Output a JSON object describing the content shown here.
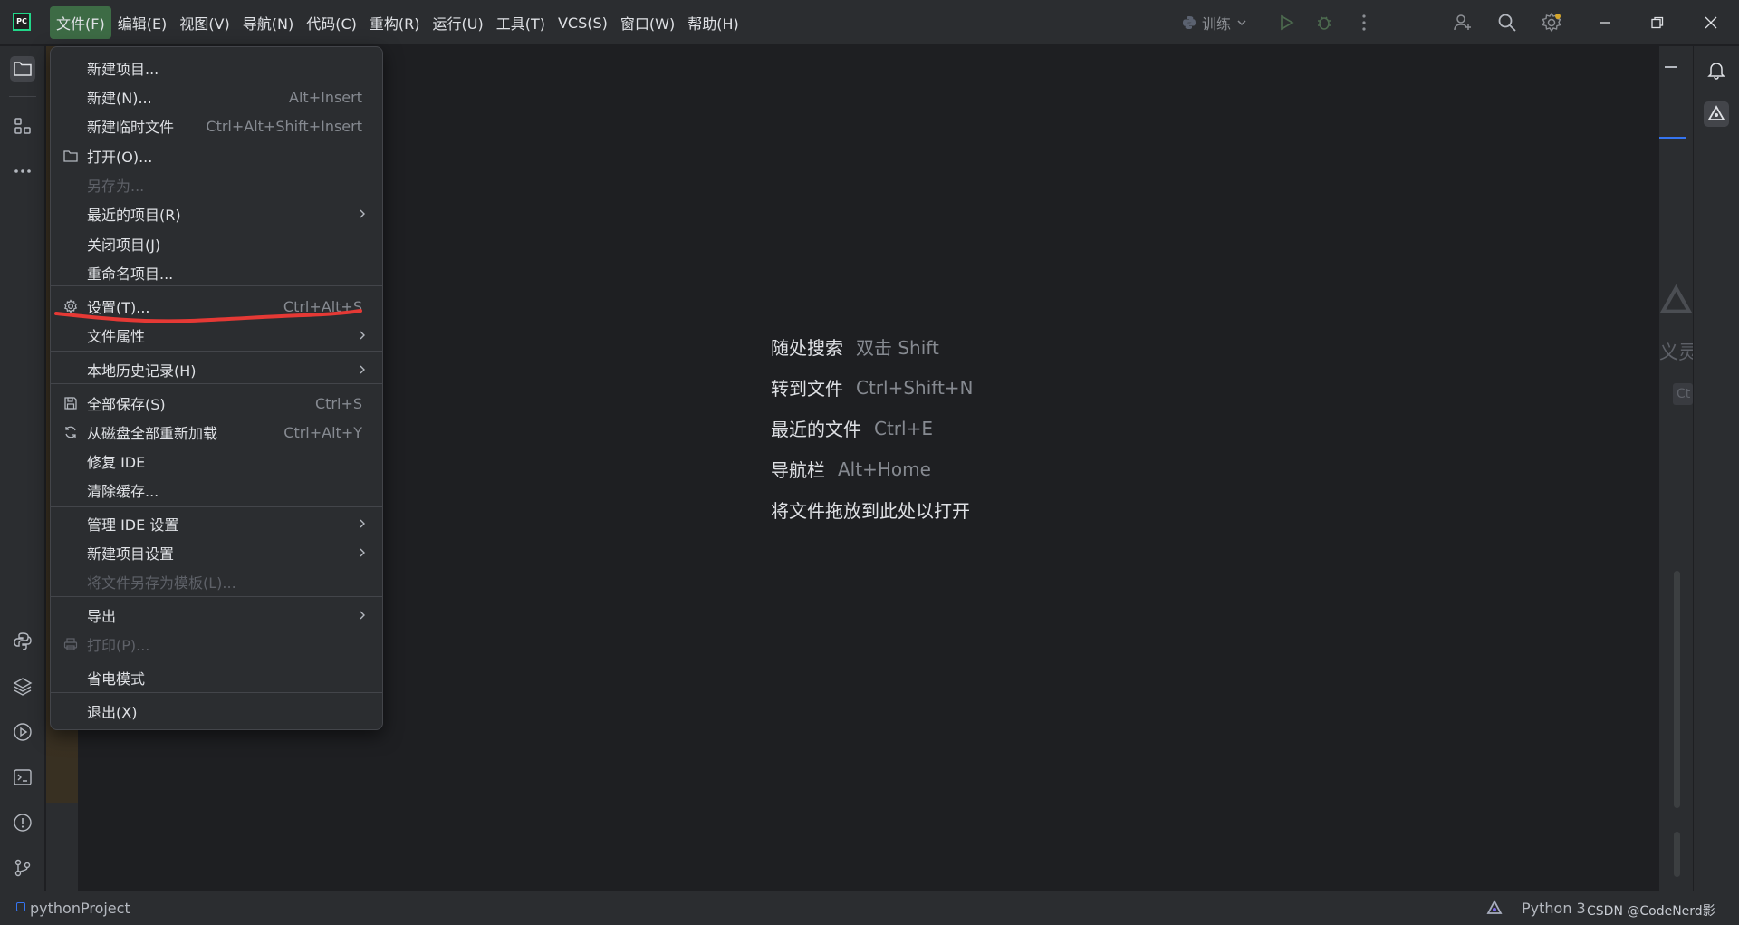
{
  "app": {
    "logo_text": "PC",
    "brand_color": "#21d789"
  },
  "menubar": {
    "items": [
      {
        "label": "文件(F)",
        "active": true
      },
      {
        "label": "编辑(E)"
      },
      {
        "label": "视图(V)"
      },
      {
        "label": "导航(N)"
      },
      {
        "label": "代码(C)"
      },
      {
        "label": "重构(R)"
      },
      {
        "label": "运行(U)"
      },
      {
        "label": "工具(T)"
      },
      {
        "label": "VCS(S)"
      },
      {
        "label": "窗口(W)"
      },
      {
        "label": "帮助(H)"
      }
    ]
  },
  "toolbar": {
    "run_config_label": "训练",
    "icons": [
      "python-icon",
      "chevron-down-icon",
      "run-icon",
      "debug-icon",
      "more-vertical-icon",
      "add-user-icon",
      "search-icon",
      "settings-icon",
      "minimize-icon",
      "restore-icon",
      "close-icon"
    ]
  },
  "file_menu": {
    "items": [
      {
        "label": "新建项目...",
        "shortcut": "",
        "submenu": false,
        "disabled": false,
        "icon": ""
      },
      {
        "label": "新建(N)...",
        "shortcut": "Alt+Insert",
        "submenu": false,
        "disabled": false,
        "icon": ""
      },
      {
        "label": "新建临时文件",
        "shortcut": "Ctrl+Alt+Shift+Insert",
        "submenu": false,
        "disabled": false,
        "icon": ""
      },
      {
        "label": "打开(O)...",
        "shortcut": "",
        "submenu": false,
        "disabled": false,
        "icon": "folder-icon"
      },
      {
        "label": "另存为...",
        "shortcut": "",
        "submenu": false,
        "disabled": true,
        "icon": ""
      },
      {
        "label": "最近的项目(R)",
        "shortcut": "",
        "submenu": true,
        "disabled": false,
        "icon": ""
      },
      {
        "label": "关闭项目(J)",
        "shortcut": "",
        "submenu": false,
        "disabled": false,
        "icon": ""
      },
      {
        "label": "重命名项目...",
        "shortcut": "",
        "submenu": false,
        "disabled": false,
        "icon": ""
      },
      {
        "label": "设置(T)...",
        "shortcut": "Ctrl+Alt+S",
        "submenu": false,
        "disabled": false,
        "icon": "gear-icon"
      },
      {
        "label": "文件属性",
        "shortcut": "",
        "submenu": true,
        "disabled": false,
        "icon": ""
      },
      {
        "label": "本地历史记录(H)",
        "shortcut": "",
        "submenu": true,
        "disabled": false,
        "icon": ""
      },
      {
        "label": "全部保存(S)",
        "shortcut": "Ctrl+S",
        "submenu": false,
        "disabled": false,
        "icon": "save-icon"
      },
      {
        "label": "从磁盘全部重新加载",
        "shortcut": "Ctrl+Alt+Y",
        "submenu": false,
        "disabled": false,
        "icon": "reload-icon"
      },
      {
        "label": "修复 IDE",
        "shortcut": "",
        "submenu": false,
        "disabled": false,
        "icon": ""
      },
      {
        "label": "清除缓存...",
        "shortcut": "",
        "submenu": false,
        "disabled": false,
        "icon": ""
      },
      {
        "label": "管理 IDE 设置",
        "shortcut": "",
        "submenu": true,
        "disabled": false,
        "icon": ""
      },
      {
        "label": "新建项目设置",
        "shortcut": "",
        "submenu": true,
        "disabled": false,
        "icon": ""
      },
      {
        "label": "将文件另存为模板(L)...",
        "shortcut": "",
        "submenu": false,
        "disabled": true,
        "icon": ""
      },
      {
        "label": "导出",
        "shortcut": "",
        "submenu": true,
        "disabled": false,
        "icon": ""
      },
      {
        "label": "打印(P)...",
        "shortcut": "",
        "submenu": false,
        "disabled": true,
        "icon": "print-icon"
      },
      {
        "label": "省电模式",
        "shortcut": "",
        "submenu": false,
        "disabled": false,
        "icon": ""
      },
      {
        "label": "退出(X)",
        "shortcut": "",
        "submenu": false,
        "disabled": false,
        "icon": ""
      }
    ],
    "highlight_color": "#e53935"
  },
  "editor": {
    "hints": [
      {
        "label": "随处搜索",
        "shortcut": "双击 Shift"
      },
      {
        "label": "转到文件",
        "shortcut": "Ctrl+Shift+N"
      },
      {
        "label": "最近的文件",
        "shortcut": "Ctrl+E"
      },
      {
        "label": "导航栏",
        "shortcut": "Alt+Home"
      },
      {
        "label": "将文件拖放到此处以打开",
        "shortcut": ""
      }
    ]
  },
  "left_toolbar": {
    "icons": [
      "folder-icon",
      "structure-icon",
      "more-horizontal-icon",
      "python-console-icon",
      "layers-icon",
      "services-icon",
      "terminal-icon",
      "problems-icon",
      "git-icon"
    ]
  },
  "right_toolbar": {
    "icons": [
      "bell-icon",
      "ai-assistant-icon"
    ]
  },
  "right_panel": {
    "partial_text": "义灵",
    "partial_shortcut": "Ct"
  },
  "statusbar": {
    "project": "pythonProject",
    "interpreter": "Python 3",
    "watermark": "CSDN @CodeNerd影"
  }
}
